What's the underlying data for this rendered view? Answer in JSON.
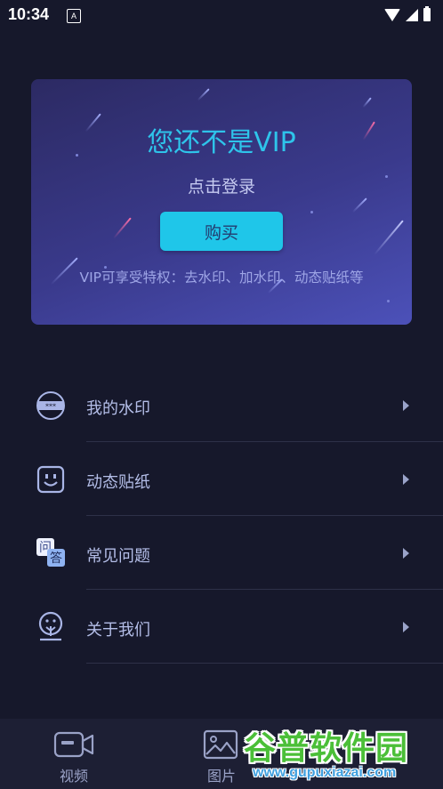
{
  "status_bar": {
    "time": "10:34",
    "notification_letter": "A"
  },
  "vip_card": {
    "title": "您还不是VIP",
    "login_text": "点击登录",
    "buy_label": "购买",
    "description": "VIP可享受特权：去水印、加水印、动态贴纸等"
  },
  "menu": {
    "items": [
      {
        "label": "我的水印",
        "icon": "watermark-icon"
      },
      {
        "label": "动态贴纸",
        "icon": "sticker-smile-icon"
      },
      {
        "label": "常见问题",
        "icon": "qa-icon"
      },
      {
        "label": "关于我们",
        "icon": "about-tree-icon"
      }
    ]
  },
  "tab_bar": {
    "tabs": [
      {
        "label": "视频",
        "icon": "video-icon"
      },
      {
        "label": "图片",
        "icon": "image-icon"
      }
    ]
  },
  "watermark": {
    "title": "谷普软件园",
    "url": "www.gupuxiazai.com"
  },
  "colors": {
    "accent": "#1fc6e9",
    "background": "#16182b",
    "card_start": "#2c2a63",
    "card_end": "#4c51b9",
    "watermark_green": "#4bbf38"
  }
}
